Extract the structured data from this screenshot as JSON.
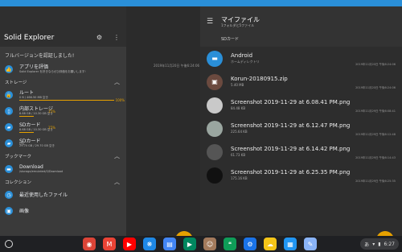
{
  "drawer": {
    "title": "Solid Explorer",
    "settings_icon": "gear-icon",
    "more_icon": "more-vert-icon",
    "promo": "フルバージョンを認証しました!",
    "rate": {
      "label": "アプリを評価",
      "sub": "Solid Explorer を好きならぜひ評価をお願いします!"
    },
    "storage_header": "ストレージ",
    "storage": [
      {
        "label": "ルート",
        "sub": "0 B / 466.50 MB 空き",
        "percent": "100%",
        "fill": 1.0
      },
      {
        "label": "内部ストレージ",
        "sub": "8.68 GB / 10.30 GB 空き",
        "percent": "15%",
        "fill": 0.15
      },
      {
        "label": "SDカード",
        "sub": "8.68 GB / 10.30 GB 空き",
        "percent": "15%",
        "fill": 0.15
      },
      {
        "label": "SDカード",
        "sub": "29.70 GB / 29.70 GB 空き",
        "percent": "0%",
        "fill": 0.0
      }
    ],
    "bookmark_header": "ブックマーク",
    "bookmarks": [
      {
        "label": "Download",
        "sub": "/storage/emulated/0/Download"
      }
    ],
    "collection_header": "コレクション",
    "collections": [
      {
        "label": "最近使用したファイル"
      },
      {
        "label": "画像"
      }
    ]
  },
  "middle": {
    "date": "2019年11月20日 午後6:24:06",
    "fab": "+"
  },
  "right": {
    "title": "マイファイル",
    "subtitle": "1フォルダと5ファイル",
    "breadcrumb": "SDカード",
    "fab": "+",
    "files": [
      {
        "name": "Android",
        "size": "ホームディレクトリ",
        "date": "2019年11月20日 午後6:24:06",
        "icon": "folder-icon",
        "color": "#2a8fd8"
      },
      {
        "name": "Korun-20180915.zip",
        "size": "5.40 MB",
        "date": "2019年11月20日 午後6:24:06",
        "icon": "archive-icon",
        "color": "#6b4a3f"
      },
      {
        "name": "Screenshot 2019-11-29 at 6.08.41 PM.png",
        "size": "84.48 KB",
        "date": "2019年11月29日 午後6:08:41",
        "icon": "image-thumb",
        "color": "#c9c9c9"
      },
      {
        "name": "Screenshot 2019-11-29 at 6.12.47 PM.png",
        "size": "225.64 KB",
        "date": "2019年11月29日 午後6:12:48",
        "icon": "image-thumb",
        "color": "#9aa6a0"
      },
      {
        "name": "Screenshot 2019-11-29 at 6.14.42 PM.png",
        "size": "61.73 KB",
        "date": "2019年11月29日 午後6:14:43",
        "icon": "image-thumb",
        "color": "#555"
      },
      {
        "name": "Screenshot 2019-11-29 at 6.25.35 PM.png",
        "size": "175.16 KB",
        "date": "2019年11月29日 午後6:25:35",
        "icon": "image-thumb",
        "color": "#111"
      }
    ]
  },
  "taskbar": {
    "apps": [
      {
        "name": "chrome-icon",
        "color": "#db4437",
        "glyph": "◉"
      },
      {
        "name": "gmail-icon",
        "color": "#ea4335",
        "glyph": "M"
      },
      {
        "name": "youtube-icon",
        "color": "#ff0000",
        "glyph": "▶"
      },
      {
        "name": "paw-icon",
        "color": "#1e88e5",
        "glyph": "❋"
      },
      {
        "name": "files-icon",
        "color": "#4285f4",
        "glyph": "▤"
      },
      {
        "name": "play-store-icon",
        "color": "#01875f",
        "glyph": "▶"
      },
      {
        "name": "pet-icon",
        "color": "#a37a5c",
        "glyph": "☺"
      },
      {
        "name": "hangouts-icon",
        "color": "#0f9d58",
        "glyph": "❝"
      },
      {
        "name": "settings-icon",
        "color": "#1a73e8",
        "glyph": "⚙"
      },
      {
        "name": "weather-icon",
        "color": "#f5c518",
        "glyph": "☁"
      },
      {
        "name": "store-icon",
        "color": "#2196f3",
        "glyph": "▦"
      },
      {
        "name": "docs-icon",
        "color": "#8ab4f8",
        "glyph": "✎"
      }
    ],
    "tray_text": "あ",
    "time": "6:27"
  }
}
